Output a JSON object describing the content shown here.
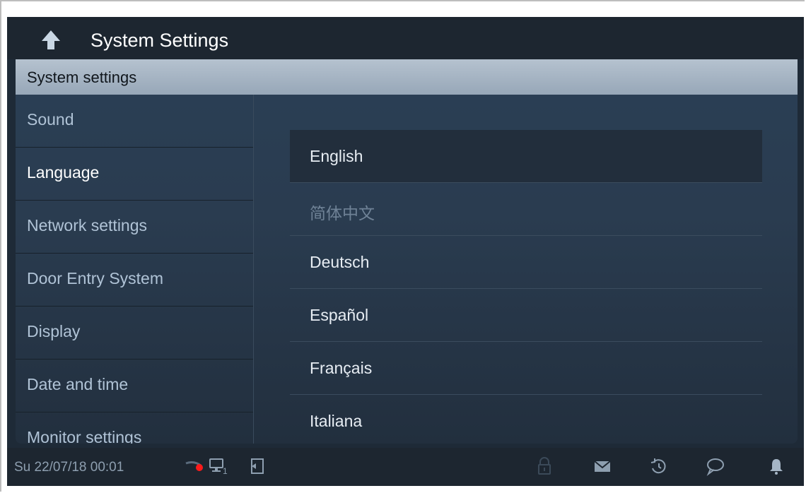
{
  "window": {
    "title": "System Settings"
  },
  "panel": {
    "header": "System settings"
  },
  "sidebar": {
    "items": [
      {
        "label": "Sound"
      },
      {
        "label": "Language"
      },
      {
        "label": "Network settings"
      },
      {
        "label": "Door Entry System"
      },
      {
        "label": "Display"
      },
      {
        "label": "Date and time"
      },
      {
        "label": "Monitor settings"
      }
    ]
  },
  "languages": {
    "items": [
      {
        "label": "English"
      },
      {
        "label": "简体中文"
      },
      {
        "label": "Deutsch"
      },
      {
        "label": "Español"
      },
      {
        "label": "Français"
      },
      {
        "label": "Italiana"
      }
    ]
  },
  "status": {
    "datetime": "Su 22/07/18  00:01",
    "monitor_index": "1"
  },
  "colors": {
    "background": "#1e2a37",
    "header": "#b5c2cf",
    "accent_red": "#ff1a1a"
  },
  "icons": [
    "back-arrow-icon",
    "camera-recording-icon",
    "monitor-icon",
    "door-release-icon",
    "lock-icon",
    "mail-icon",
    "history-icon",
    "chat-icon",
    "bell-icon"
  ]
}
